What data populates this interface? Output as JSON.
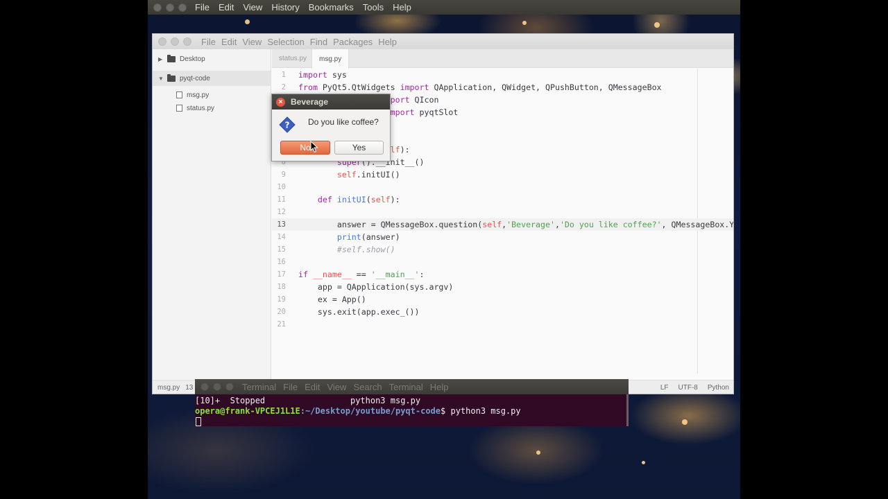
{
  "browser": {
    "menu": [
      "File",
      "Edit",
      "View",
      "History",
      "Bookmarks",
      "Tools",
      "Help"
    ]
  },
  "editor": {
    "menu": [
      "File",
      "Edit",
      "View",
      "Selection",
      "Find",
      "Packages",
      "Help"
    ],
    "tree": {
      "root": "Desktop",
      "project": "pyqt-code",
      "files": [
        "msg.py",
        "status.py"
      ]
    },
    "tabs": [
      "status.py",
      "msg.py"
    ],
    "status_bar": {
      "file": "msg.py",
      "position": "13",
      "line_ending": "LF",
      "encoding": "UTF-8",
      "grammar": "Python"
    }
  },
  "dialog": {
    "title": "Beverage",
    "message": "Do you like coffee?",
    "no_label": "No",
    "yes_label": "Yes",
    "close_glyph": "×"
  },
  "terminal": {
    "title": "Terminal",
    "menu": [
      "File",
      "Edit",
      "View",
      "Search",
      "Terminal",
      "Help"
    ],
    "job_line": "[10]+  Stopped                 python3 msg.py",
    "prompt_user": "opera@frank-VPCEJ1L1E",
    "prompt_path": ":~/Desktop/youtube/pyqt-code",
    "prompt_cmd": "$ python3 msg.py"
  }
}
